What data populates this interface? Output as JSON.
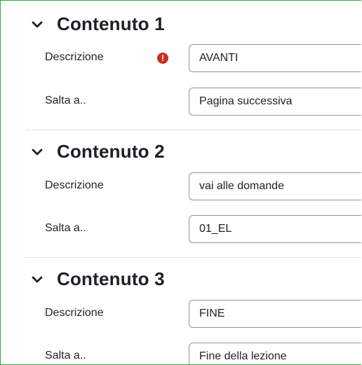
{
  "sections": [
    {
      "title": "Contenuto 1",
      "description_label": "Descrizione",
      "description_value": "AVANTI",
      "jump_label": "Salta a..",
      "jump_value": "Pagina successiva"
    },
    {
      "title": "Contenuto 2",
      "description_label": "Descrizione",
      "description_value": "vai alle domande",
      "jump_label": "Salta a..",
      "jump_value": "01_EL"
    },
    {
      "title": "Contenuto 3",
      "description_label": "Descrizione",
      "description_value": "FINE",
      "jump_label": "Salta a..",
      "jump_value": "Fine della lezione"
    }
  ],
  "required_icon": "!",
  "colors": {
    "required": "#ca3120",
    "frame_border": "#2ea84a"
  }
}
